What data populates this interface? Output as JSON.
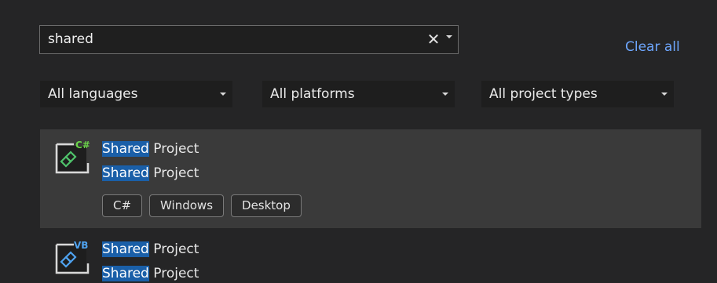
{
  "search": {
    "value": "shared",
    "clear_glyph": "✕"
  },
  "clear_all_label": "Clear all",
  "filters": {
    "language": "All languages",
    "platform": "All platforms",
    "project_type": "All project types"
  },
  "results": [
    {
      "icon": "csharp-shared-project-icon",
      "badge": "C#",
      "badge_color": "#6bd44a",
      "title_highlight": "Shared",
      "title_rest": " Project",
      "subtitle_highlight": "Shared",
      "subtitle_rest": " Project",
      "tags": [
        "C#",
        "Windows",
        "Desktop"
      ],
      "selected": true
    },
    {
      "icon": "vb-shared-project-icon",
      "badge": "VB",
      "badge_color": "#4fa3f0",
      "title_highlight": "Shared",
      "title_rest": " Project",
      "subtitle_highlight": "Shared",
      "subtitle_rest": " Project",
      "selected": false
    }
  ],
  "colors": {
    "background": "#252526",
    "selected_row": "#3a3a3a",
    "link": "#6ea7ff",
    "highlight": "#1a5fa8"
  }
}
